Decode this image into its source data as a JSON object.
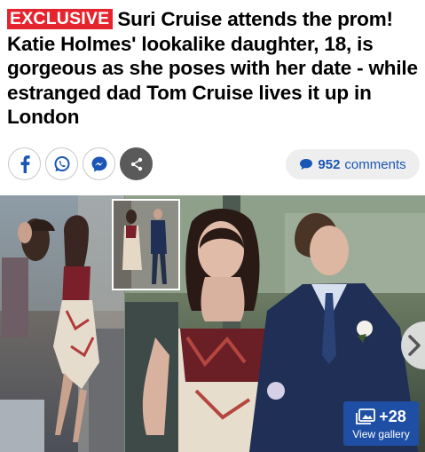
{
  "article": {
    "badge": "EXCLUSIVE",
    "headline": "Suri Cruise attends the prom! Katie Holmes' lookalike daughter, 18, is gorgeous as she poses with her date - while estranged dad Tom Cruise lives it up in London"
  },
  "share": {
    "buttons": [
      {
        "name": "facebook",
        "icon": "facebook-icon"
      },
      {
        "name": "whatsapp",
        "icon": "whatsapp-icon"
      },
      {
        "name": "messenger",
        "icon": "messenger-icon"
      },
      {
        "name": "more",
        "icon": "share-icon"
      }
    ]
  },
  "comments": {
    "count": "952",
    "label": "comments",
    "icon": "speech-bubble-icon"
  },
  "gallery": {
    "count": "+28",
    "label": "View gallery",
    "icons": [
      "photos-icon",
      "chevron-right-icon"
    ]
  },
  "colors": {
    "badge": "#e5242d",
    "link": "#1b55b5",
    "gallery_button": "#1e4fa5"
  }
}
